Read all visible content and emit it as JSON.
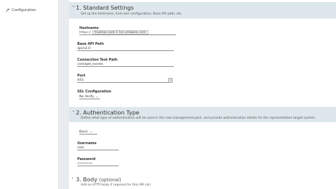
{
  "sidebar": {
    "items": [
      {
        "label": "Configuration",
        "icon": "wrench-icon"
      }
    ]
  },
  "sections": {
    "standard": {
      "chevron": "⌄",
      "title": "1. Standard Settings",
      "description": "Set up the Hostname, End-user configuration, Base API path, etc.",
      "hostname": {
        "label": "Hostname",
        "prefix": "https://",
        "value": "truenas-core-1.tvs.vmware.com"
      },
      "base_api": {
        "label": "Base API Path",
        "value": "api/v2.0"
      },
      "test_path": {
        "label": "Connection Test Path",
        "value": "core/get_events"
      },
      "port": {
        "label": "Port",
        "value": "443"
      },
      "ssl": {
        "label": "SSL Configuration",
        "value": "No Verify",
        "chevron": "⌄"
      }
    },
    "auth": {
      "chevron": "⌄",
      "title": "2. Authentication Type",
      "description": "Define what type of authentication will be used in the new management pack, and provide authentication details for the representative target system.",
      "type": {
        "value": "Basic",
        "chevron": "⌄"
      },
      "username": {
        "label": "Username",
        "value": "root"
      },
      "password": {
        "label": "Password",
        "value": "••••••••"
      }
    },
    "body": {
      "chevron": "›",
      "title": "3. Body",
      "optional": "(optional)",
      "description": "Add an HTTP body if required for this API call."
    }
  }
}
